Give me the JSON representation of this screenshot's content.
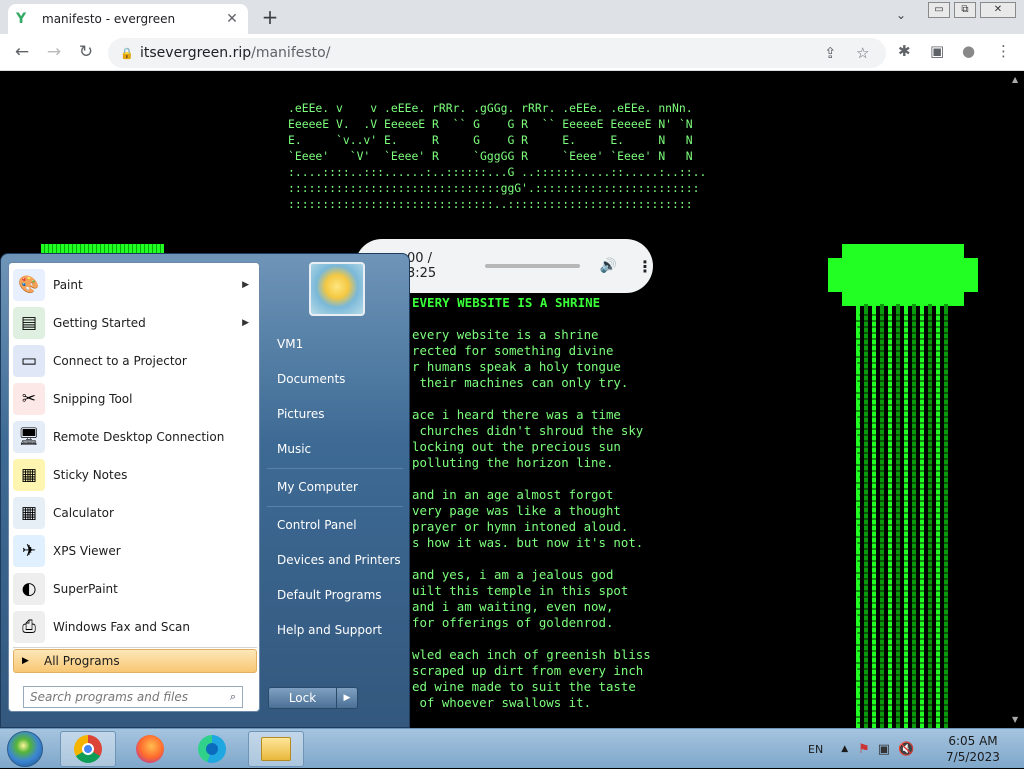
{
  "browser": {
    "tab": {
      "title": "manifesto - evergreen",
      "favicon": "Y",
      "close": "✕"
    },
    "new_tab": "+",
    "tab_menu": "⌄",
    "window_controls": {
      "minimize": "▭",
      "restore": "⧉",
      "close": "✕"
    },
    "nav": {
      "back": "←",
      "forward": "→",
      "reload": "↻"
    },
    "url": {
      "host": "itsevergreen.rip",
      "path": "/manifesto/"
    },
    "toolbar_icons": {
      "share": "⇪",
      "star": "☆",
      "extensions": "✱",
      "sidepanel": "▣",
      "profile": "●",
      "menu": "⋮"
    }
  },
  "page": {
    "ascii_art": [
      ".eEEe. v    v .eEEe. rRRr. .gGGg. rRRr. .eEEe. .eEEe. nnNn.",
      "EeeeeE V.  .V EeeeeE R  `` G    G R  `` EeeeeE EeeeeE N' `N",
      "E.     `v..v' E.     R     G    G R     E.     E.     N   N",
      "`Eeee'   `V'  `Eeee' R     `GggGG R     `Eeee' `Eeee' N   N",
      ":....::::..:::......:..::::::...G ..::::::.....::.....:..::..",
      ":::::::::::::::::::::::::::::::ggG'.::::::::::::::::::::::::",
      "::::::::::::::::::::::::::::::..:::::::::::::::::::::::::::"
    ],
    "audio": {
      "time": "00 / 3:25",
      "volume_icon": "🔊",
      "more_icon": "⋮",
      "progress": 0.0
    },
    "headline": "EVERY WEBSITE IS A SHRINE",
    "poem": [
      "every website is a shrine",
      "rected for something divine",
      "r humans speak a holy tongue",
      " their machines can only try.",
      "",
      "ace i heard there was a time",
      " churches didn't shroud the sky",
      "locking out the precious sun",
      "polluting the horizon line.",
      "",
      "and in an age almost forgot",
      "very page was like a thought",
      "prayer or hymn intoned aloud.",
      "s how it was. but now it's not.",
      "",
      "and yes, i am a jealous god",
      "uilt this temple in this spot",
      "and i am waiting, even now,",
      "for offerings of goldenrod.",
      "",
      "wled each inch of greenish bliss",
      "scraped up dirt from every inch",
      "ed wine made to suit the taste",
      " of whoever swallows it."
    ],
    "pillar_color": "#22ff22"
  },
  "start_menu": {
    "programs": [
      {
        "label": "Paint",
        "icon": "paint-icon",
        "glyph": "🎨",
        "bg": "#e8f0ff",
        "has_submenu": true
      },
      {
        "label": "Getting Started",
        "icon": "getting-started-icon",
        "glyph": "▤",
        "bg": "#dff0e0",
        "has_submenu": true
      },
      {
        "label": "Connect to a Projector",
        "icon": "projector-icon",
        "glyph": "▭",
        "bg": "#e0e8f8",
        "has_submenu": false
      },
      {
        "label": "Snipping Tool",
        "icon": "scissors-icon",
        "glyph": "✂",
        "bg": "#fde8e8",
        "has_submenu": false
      },
      {
        "label": "Remote Desktop Connection",
        "icon": "remote-desktop-icon",
        "glyph": "🖥",
        "bg": "#e4ecf8",
        "has_submenu": false
      },
      {
        "label": "Sticky Notes",
        "icon": "sticky-notes-icon",
        "glyph": "▦",
        "bg": "#fdf5b0",
        "has_submenu": false
      },
      {
        "label": "Calculator",
        "icon": "calculator-icon",
        "glyph": "▦",
        "bg": "#e6eef6",
        "has_submenu": false
      },
      {
        "label": "XPS Viewer",
        "icon": "xps-viewer-icon",
        "glyph": "✈",
        "bg": "#e0f0ff",
        "has_submenu": false
      },
      {
        "label": "SuperPaint",
        "icon": "superpaint-icon",
        "glyph": "◐",
        "bg": "#eee",
        "has_submenu": false
      },
      {
        "label": "Windows Fax and Scan",
        "icon": "fax-icon",
        "glyph": "⎙",
        "bg": "#eee",
        "has_submenu": false
      }
    ],
    "all_programs": "All Programs",
    "search_placeholder": "Search programs and files",
    "search_icon": "⌕",
    "right_links": [
      "VM1",
      "Documents",
      "Pictures",
      "Music",
      "My Computer",
      "Control Panel",
      "Devices and Printers",
      "Default Programs",
      "Help and Support"
    ],
    "lock_label": "Lock",
    "lock_arrow": "▶"
  },
  "taskbar": {
    "lang": "EN",
    "tray_up": "▲",
    "tray_icons": [
      "⚑",
      "▣",
      "🔇"
    ],
    "time": "6:05 AM",
    "date": "7/5/2023"
  }
}
